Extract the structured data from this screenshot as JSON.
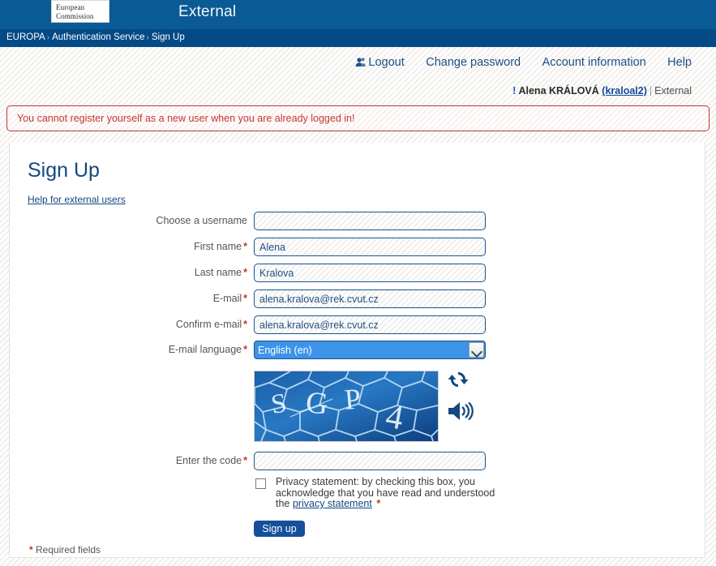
{
  "banner": {
    "logo_line1": "European",
    "logo_line2": "Commission",
    "app_title": "External"
  },
  "breadcrumb": {
    "items": [
      "EUROPA",
      "Authentication Service",
      "Sign Up"
    ],
    "separator": "›"
  },
  "utilnav": {
    "logout": "Logout",
    "change_password": "Change password",
    "account_information": "Account information",
    "help": "Help",
    "logout_icon": "person-icon"
  },
  "userline": {
    "bang": "!",
    "display_name": "Alena KRÁLOVÁ",
    "login": "(kraloal2)",
    "pipe": "|",
    "domain": "External"
  },
  "error": {
    "message": "You cannot register yourself as a new user when you are already logged in!"
  },
  "page": {
    "title": "Sign Up",
    "help_link": "Help for external users",
    "required_note_star": "*",
    "required_note": " Required fields"
  },
  "form": {
    "fields": [
      {
        "label": "Choose a username",
        "required": false,
        "value": "",
        "name": "username"
      },
      {
        "label": "First name",
        "required": true,
        "value": "Alena",
        "name": "first-name"
      },
      {
        "label": "Last name",
        "required": true,
        "value": "Kralova",
        "name": "last-name"
      },
      {
        "label": "E-mail",
        "required": true,
        "value": "alena.kralova@rek.cvut.cz",
        "name": "email"
      },
      {
        "label": "Confirm e-mail",
        "required": true,
        "value": "alena.kralova@rek.cvut.cz",
        "name": "confirm-email"
      }
    ],
    "language": {
      "label": "E-mail language",
      "required": true,
      "selected": "English (en)",
      "options": [
        "English (en)"
      ]
    },
    "code": {
      "label": "Enter the code",
      "required": true,
      "value": ""
    },
    "privacy": {
      "checked": false,
      "text_before": "Privacy statement: by checking this box, you acknowledge that you have read and understood the ",
      "link_text": "privacy statement",
      "star": "*"
    },
    "submit_label": "Sign up",
    "required_marker": "*"
  },
  "captcha": {
    "code_text": "SGP4",
    "refresh_icon": "refresh-icon",
    "audio_icon": "speaker-icon"
  },
  "colors": {
    "banner_blue": "#0a5a96",
    "breadcrumb_blue": "#034a86",
    "link_blue": "#14487f",
    "error_red": "#c0392b",
    "required_red": "#cc3322",
    "button_blue": "#14509b",
    "select_highlight": "#3d93e8"
  }
}
